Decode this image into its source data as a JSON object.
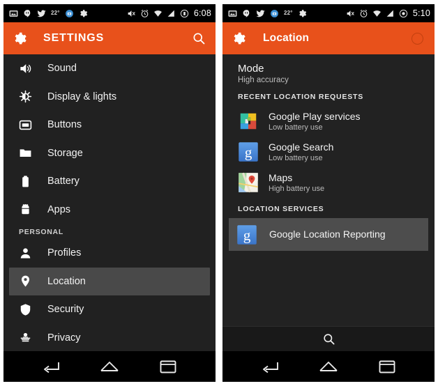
{
  "left_phone": {
    "statusbar": {
      "icons_left": [
        "screenshot-icon",
        "hangouts-icon",
        "twitter-icon",
        "temperature-label",
        "blue-app-icon",
        "gear-icon"
      ],
      "temperature": "22°",
      "icons_right": [
        "mute-icon",
        "alarm-icon",
        "wifi-icon",
        "signal-icon",
        "battery-icon"
      ],
      "time": "6:08"
    },
    "appbar": {
      "title": "SETTINGS",
      "left_icon": "gear-icon",
      "right_icon": "search-icon"
    },
    "items": [
      {
        "label": "Sound",
        "icon": "speaker-icon",
        "trailing": "none",
        "selected": false
      },
      {
        "label": "Display & lights",
        "icon": "brightness-icon",
        "trailing": "none",
        "selected": false
      },
      {
        "label": "Buttons",
        "icon": "buttons-icon",
        "trailing": "none",
        "selected": false
      },
      {
        "label": "Storage",
        "icon": "folder-icon",
        "trailing": "none",
        "selected": false
      },
      {
        "label": "Battery",
        "icon": "battery-icon",
        "trailing": "none",
        "selected": false
      },
      {
        "label": "Apps",
        "icon": "android-icon",
        "trailing": "none",
        "selected": false
      }
    ],
    "section_header": "PERSONAL",
    "personal_items": [
      {
        "label": "Profiles",
        "icon": "person-icon",
        "trailing": "grey-dot",
        "selected": false
      },
      {
        "label": "Location",
        "icon": "map-pin-icon",
        "trailing": "orange-dot",
        "selected": true
      },
      {
        "label": "Security",
        "icon": "shield-icon",
        "trailing": "none",
        "selected": false
      },
      {
        "label": "Privacy",
        "icon": "spy-icon",
        "trailing": "none",
        "selected": false
      }
    ]
  },
  "right_phone": {
    "statusbar": {
      "temperature": "22°",
      "time": "5:10"
    },
    "appbar": {
      "title": "Location",
      "left_icon": "gear-icon",
      "right_icon": "toggle-circle"
    },
    "mode": {
      "title": "Mode",
      "subtitle": "High accuracy"
    },
    "recent_header": "RECENT LOCATION REQUESTS",
    "recent_requests": [
      {
        "name": "Google Play services",
        "sub": "Low battery use",
        "icon": "google-play-services-icon"
      },
      {
        "name": "Google Search",
        "sub": "Low battery use",
        "icon": "google-search-icon"
      },
      {
        "name": "Maps",
        "sub": "High battery use",
        "icon": "google-maps-icon"
      }
    ],
    "services_header": "LOCATION SERVICES",
    "services": [
      {
        "name": "Google Location Reporting",
        "icon": "google-search-icon",
        "selected": true
      }
    ],
    "search_icon": "search-icon"
  },
  "navbar": {
    "back": "back-icon",
    "home": "home-icon",
    "recents": "recents-icon"
  },
  "colors": {
    "accent_orange": "#e8511b",
    "dot_orange": "#f4511e",
    "selected_row": "#494949",
    "background": "#212121"
  }
}
